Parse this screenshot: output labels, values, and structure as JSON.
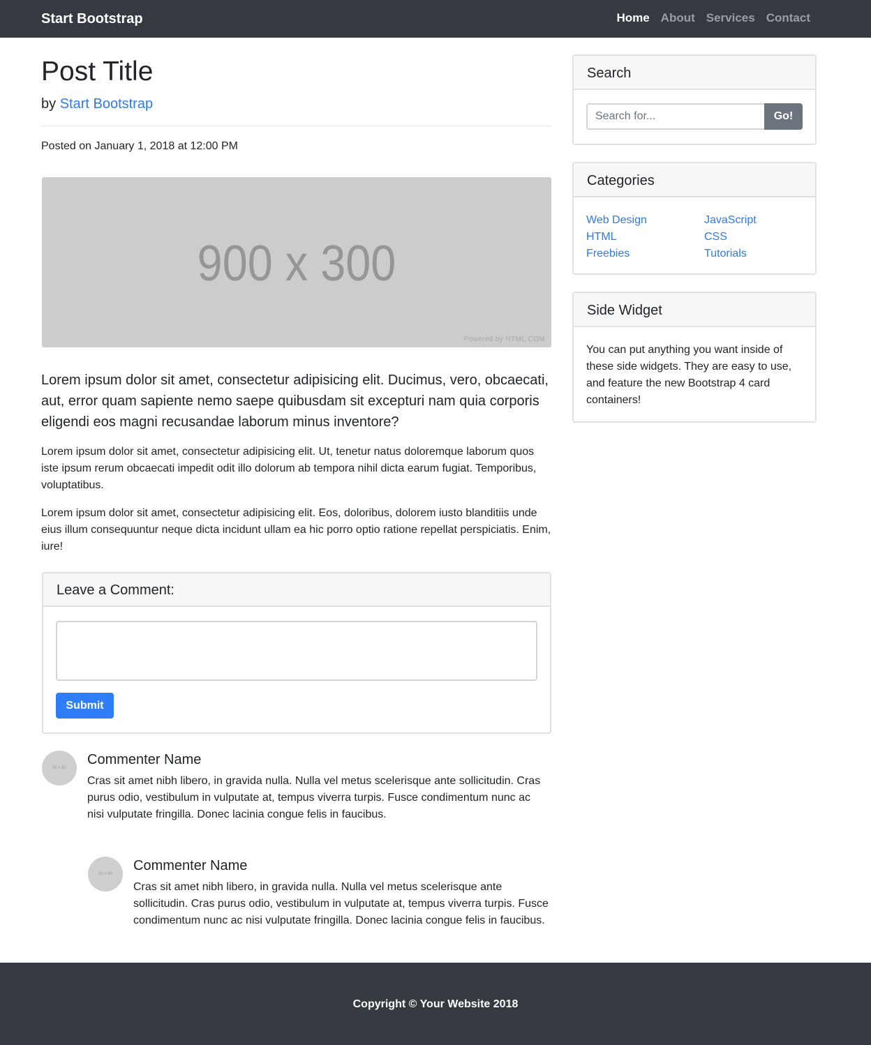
{
  "navbar": {
    "brand": "Start Bootstrap",
    "links": [
      {
        "label": "Home",
        "active": true
      },
      {
        "label": "About",
        "active": false
      },
      {
        "label": "Services",
        "active": false
      },
      {
        "label": "Contact",
        "active": false
      }
    ]
  },
  "post": {
    "title": "Post Title",
    "by_prefix": "by",
    "author": "Start Bootstrap",
    "posted_on": "Posted on January 1, 2018 at 12:00 PM",
    "image_placeholder": "900 x 300",
    "image_credit": "Powered by HTML.COM",
    "lead": "Lorem ipsum dolor sit amet, consectetur adipisicing elit. Ducimus, vero, obcaecati, aut, error quam sapiente nemo saepe quibusdam sit excepturi nam quia corporis eligendi eos magni recusandae laborum minus inventore?",
    "paragraphs": [
      "Lorem ipsum dolor sit amet, consectetur adipisicing elit. Ut, tenetur natus doloremque laborum quos iste ipsum rerum obcaecati impedit odit illo dolorum ab tempora nihil dicta earum fugiat. Temporibus, voluptatibus.",
      "Lorem ipsum dolor sit amet, consectetur adipisicing elit. Eos, doloribus, dolorem iusto blanditiis unde eius illum consequuntur neque dicta incidunt ullam ea hic porro optio ratione repellat perspiciatis. Enim, iure!"
    ]
  },
  "comment_form": {
    "title": "Leave a Comment:",
    "textarea_value": "",
    "submit_label": "Submit"
  },
  "comments": [
    {
      "avatar_text": "50 x 50",
      "name": "Commenter Name",
      "body": "Cras sit amet nibh libero, in gravida nulla. Nulla vel metus scelerisque ante sollicitudin. Cras purus odio, vestibulum in vulputate at, tempus viverra turpis. Fusce condimentum nunc ac nisi vulputate fringilla. Donec lacinia congue felis in faucibus."
    },
    {
      "avatar_text": "50 x 50",
      "name": "Commenter Name",
      "body": "Cras sit amet nibh libero, in gravida nulla. Nulla vel metus scelerisque ante sollicitudin. Cras purus odio, vestibulum in vulputate at, tempus viverra turpis. Fusce condimentum nunc ac nisi vulputate fringilla. Donec lacinia congue felis in faucibus."
    }
  ],
  "sidebar": {
    "search": {
      "title": "Search",
      "placeholder": "Search for...",
      "button_label": "Go!"
    },
    "categories": {
      "title": "Categories",
      "left": [
        "Web Design",
        "HTML",
        "Freebies"
      ],
      "right": [
        "JavaScript",
        "CSS",
        "Tutorials"
      ]
    },
    "widget": {
      "title": "Side Widget",
      "text": "You can put anything you want inside of these side widgets. They are easy to use, and feature the new Bootstrap 4 card containers!"
    }
  },
  "footer": {
    "copyright": "Copyright © Your Website 2018"
  },
  "colors": {
    "navbar_bg": "#343a40",
    "link": "#2f7ae6",
    "primary_button": "#2f7ef7",
    "secondary_button": "#6c757d",
    "placeholder_image": "#cccccc"
  }
}
